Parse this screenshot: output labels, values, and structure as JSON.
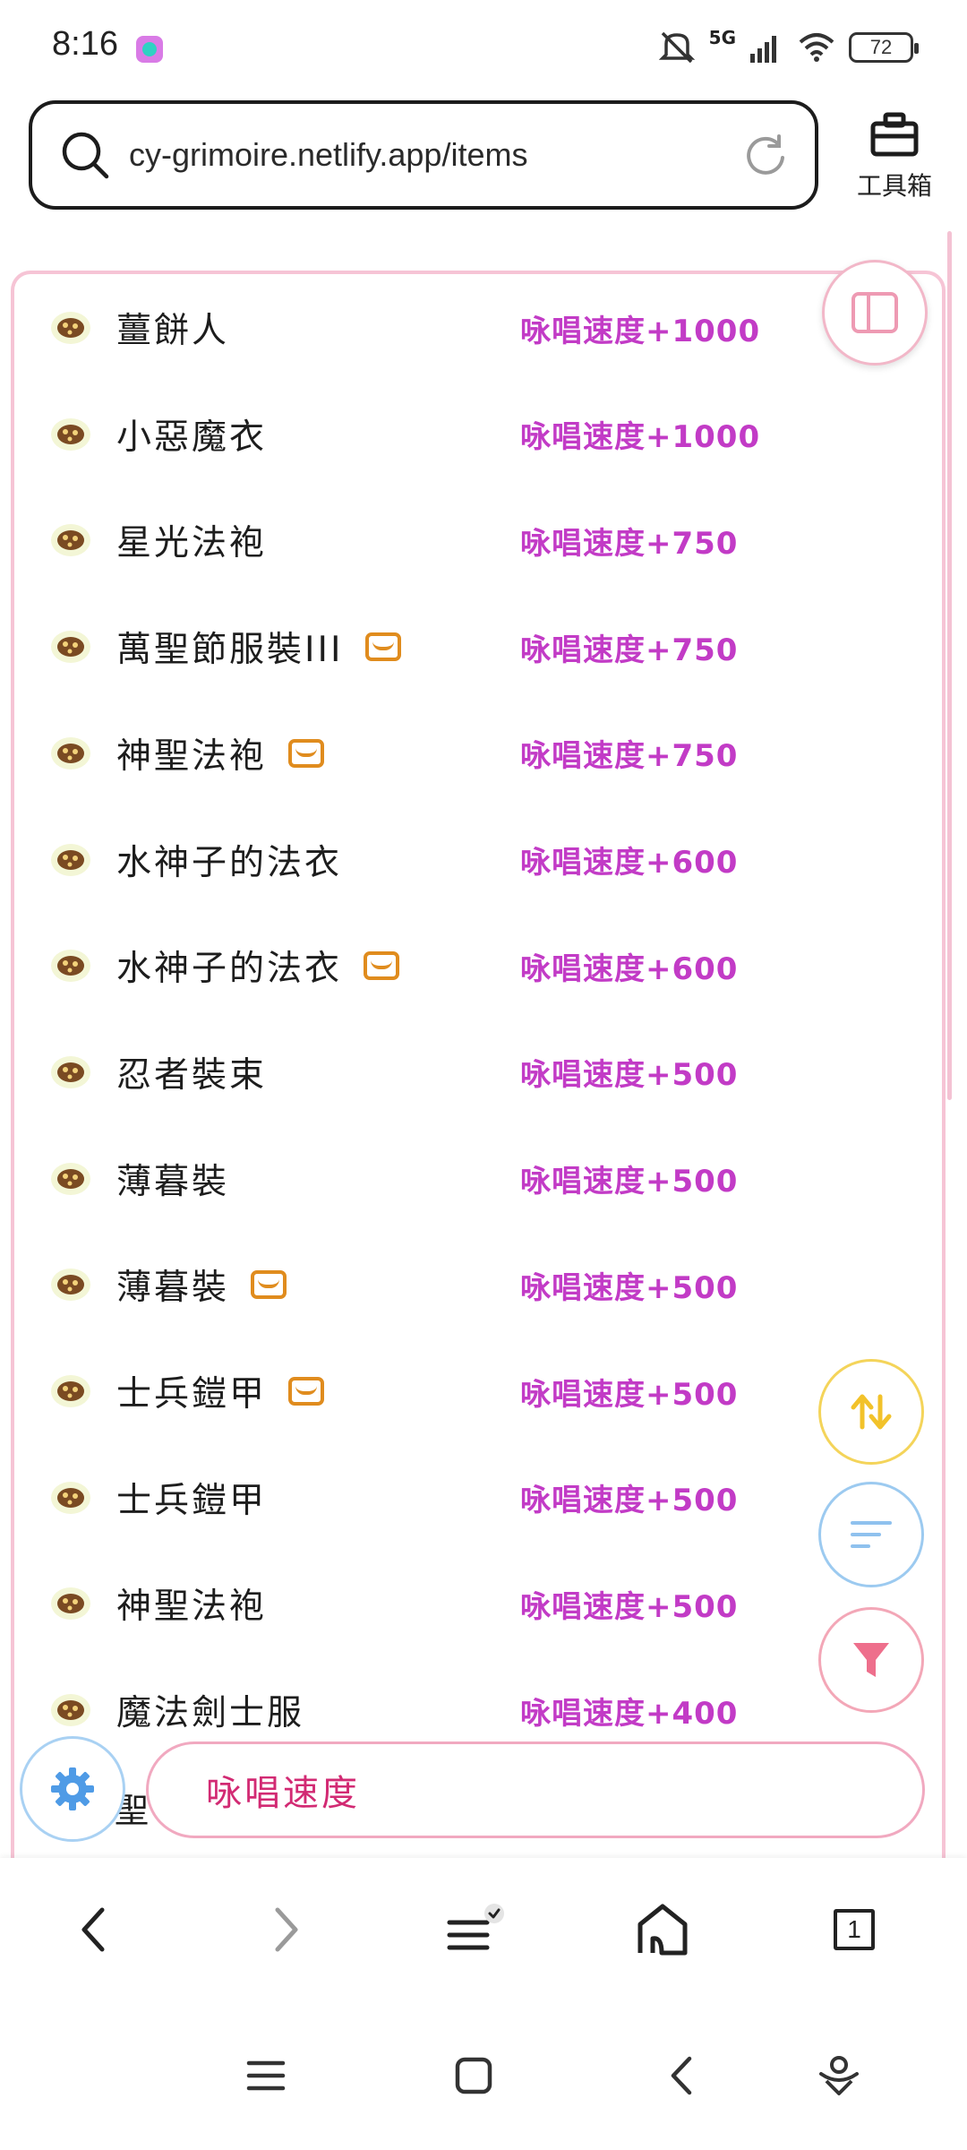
{
  "status_bar": {
    "time": "8:16",
    "network": "5G",
    "battery": "72"
  },
  "address_bar": {
    "url": "cy-grimoire.netlify.app/items"
  },
  "toolbox": {
    "label": "工具箱"
  },
  "items": [
    {
      "name": "薑餅人",
      "effect": "咏唱速度+1000",
      "card": false
    },
    {
      "name": "小惡魔衣",
      "effect": "咏唱速度+1000",
      "card": false
    },
    {
      "name": "星光法袍",
      "effect": "咏唱速度+750",
      "card": false
    },
    {
      "name": "萬聖節服裝III",
      "effect": "咏唱速度+750",
      "card": true
    },
    {
      "name": "神聖法袍",
      "effect": "咏唱速度+750",
      "card": true
    },
    {
      "name": "水神子的法衣",
      "effect": "咏唱速度+600",
      "card": false
    },
    {
      "name": "水神子的法衣",
      "effect": "咏唱速度+600",
      "card": true
    },
    {
      "name": "忍者裝束",
      "effect": "咏唱速度+500",
      "card": false
    },
    {
      "name": "薄暮裝",
      "effect": "咏唱速度+500",
      "card": false
    },
    {
      "name": "薄暮裝",
      "effect": "咏唱速度+500",
      "card": true
    },
    {
      "name": "士兵鎧甲",
      "effect": "咏唱速度+500",
      "card": true
    },
    {
      "name": "士兵鎧甲",
      "effect": "咏唱速度+500",
      "card": false
    },
    {
      "name": "神聖法袍",
      "effect": "咏唱速度+500",
      "card": false
    },
    {
      "name": "魔法劍士服",
      "effect": "咏唱速度+400",
      "card": false
    }
  ],
  "peek_item": "聖",
  "search_filter": {
    "text": "咏唱速度"
  },
  "browser_nav": {
    "tab_count": "1"
  },
  "colors": {
    "accent_pink": "#f6c4d5",
    "effect_purple": "#c23bc6",
    "filter_text": "#d22a73",
    "card_orange": "#e08c1e"
  },
  "icons": [
    "search-icon",
    "reload-icon",
    "toolbox-icon",
    "sidebar-toggle-icon",
    "sort-icon",
    "list-sort-icon",
    "filter-icon",
    "settings-icon",
    "back-icon",
    "forward-icon",
    "menu-icon",
    "home-icon",
    "tabs-icon",
    "item-icon",
    "card-icon"
  ]
}
